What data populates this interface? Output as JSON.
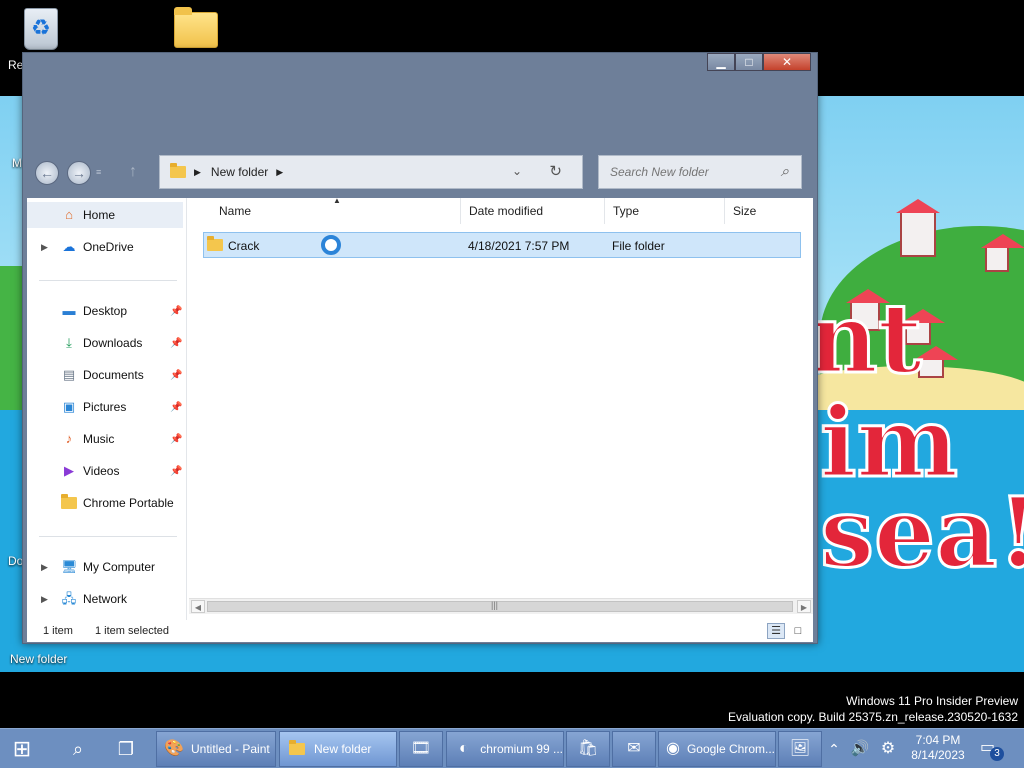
{
  "desktop": {
    "recycle_label": "Re",
    "left_labels": [
      "M",
      "Do"
    ],
    "new_folder_label": "New folder",
    "wallpaper_text": [
      "nt",
      "im",
      "sea!"
    ]
  },
  "window": {
    "controls": {
      "minimize": "▁",
      "maximize": "□",
      "close": "✕"
    },
    "address": {
      "segments": [
        "New folder"
      ]
    },
    "search_placeholder": "Search New folder",
    "nav": [
      {
        "label": "Home",
        "icon": "home-icon"
      },
      {
        "label": "OneDrive",
        "icon": "cloud-icon"
      },
      {
        "label": "Desktop",
        "icon": "desktop-icon"
      },
      {
        "label": "Downloads",
        "icon": "download-icon"
      },
      {
        "label": "Documents",
        "icon": "document-icon"
      },
      {
        "label": "Pictures",
        "icon": "picture-icon"
      },
      {
        "label": "Music",
        "icon": "music-icon"
      },
      {
        "label": "Videos",
        "icon": "video-icon"
      },
      {
        "label": "Chrome Portable",
        "icon": "folder-icon"
      },
      {
        "label": "My Computer",
        "icon": "computer-icon"
      },
      {
        "label": "Network",
        "icon": "network-icon"
      }
    ],
    "columns": [
      "Name",
      "Date modified",
      "Type",
      "Size"
    ],
    "files": [
      {
        "name": "Crack",
        "date": "4/18/2021 7:57 PM",
        "type": "File folder",
        "size": ""
      }
    ],
    "status": {
      "count": "1 item",
      "selected": "1 item selected"
    }
  },
  "watermark": {
    "line1": "Windows 11 Pro Insider Preview",
    "line2": "Evaluation copy. Build 25375.zn_release.230520-1632"
  },
  "taskbar": {
    "apps": [
      {
        "label": "Untitled - Paint",
        "icon": "paint-icon"
      },
      {
        "label": "New folder",
        "icon": "folder-icon"
      },
      {
        "label": "",
        "icon": "video-editor-icon"
      },
      {
        "label": "chromium 99 ...",
        "icon": "edge-icon"
      },
      {
        "label": "",
        "icon": "store-icon"
      },
      {
        "label": "",
        "icon": "mail-icon"
      },
      {
        "label": "Google Chrom...",
        "icon": "firefox-icon"
      },
      {
        "label": "",
        "icon": "photos-icon"
      }
    ],
    "time": "7:04 PM",
    "date": "8/14/2023",
    "notifications": "3"
  }
}
